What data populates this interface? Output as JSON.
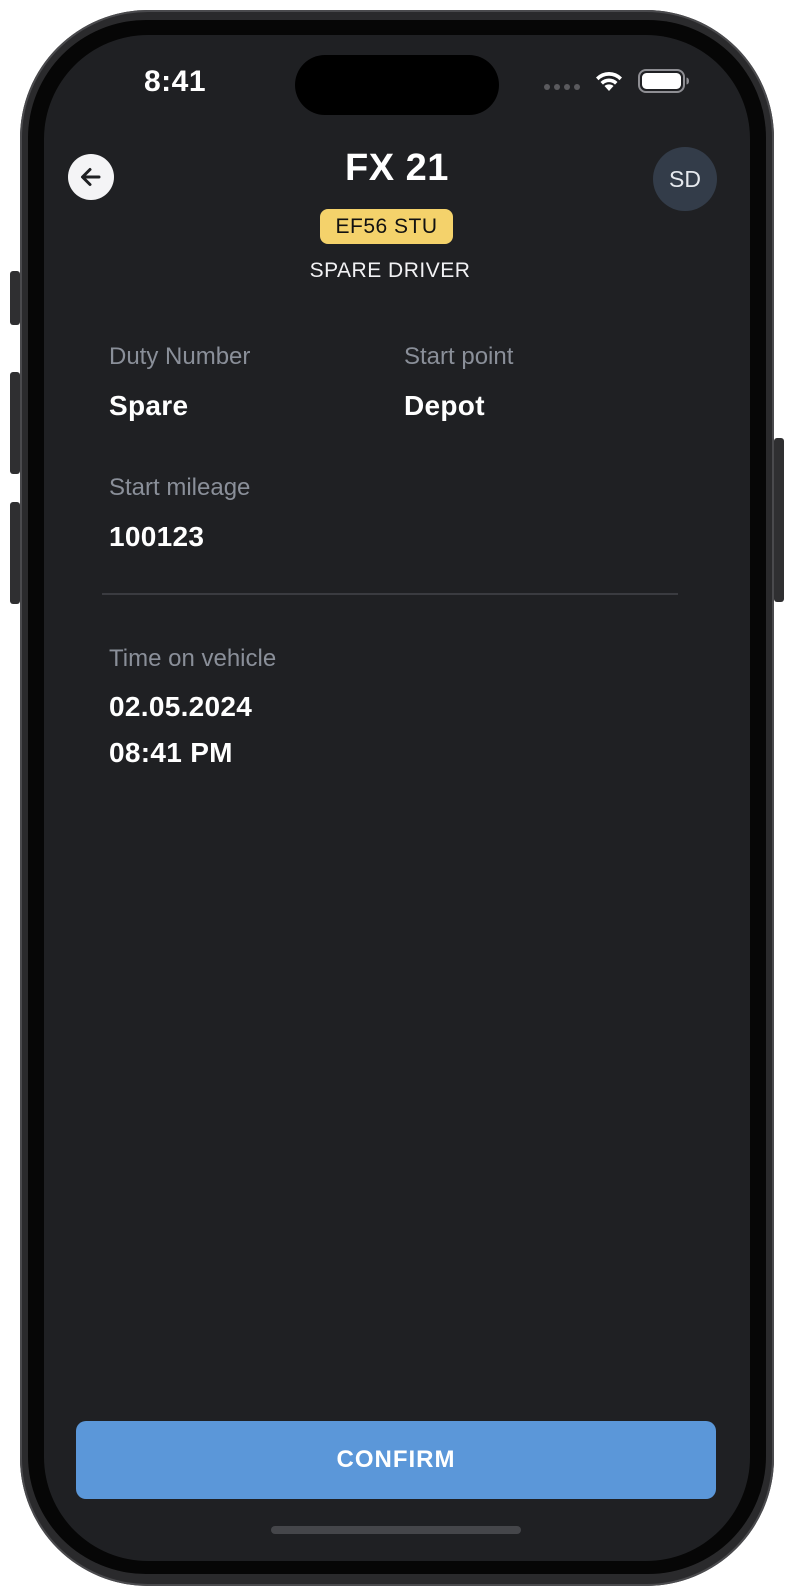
{
  "status_bar": {
    "time": "8:41"
  },
  "header": {
    "vehicle_title": "FX 21",
    "plate": "EF56 STU",
    "driver_role": "SPARE DRIVER",
    "avatar_initials": "SD"
  },
  "details": {
    "duty_number_label": "Duty Number",
    "duty_number_value": "Spare",
    "start_point_label": "Start point",
    "start_point_value": "Depot",
    "start_mileage_label": "Start mileage",
    "start_mileage_value": "100123",
    "time_on_vehicle_label": "Time on vehicle",
    "time_on_vehicle_date": "02.05.2024",
    "time_on_vehicle_time": "08:41 PM"
  },
  "actions": {
    "confirm_label": "CONFIRM"
  },
  "colors": {
    "background": "#1f2023",
    "plate_badge": "#f4d26b",
    "accent_button": "#5b97d9",
    "label_gray": "#8a8f99",
    "avatar_bg": "#333c49"
  }
}
